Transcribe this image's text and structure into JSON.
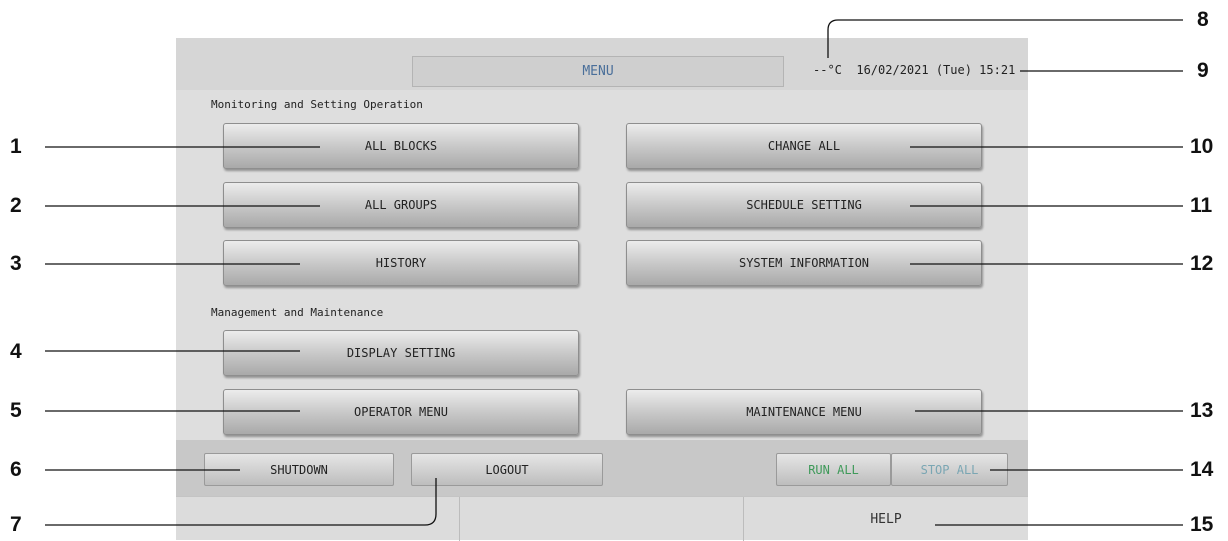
{
  "header": {
    "menu_title": "MENU",
    "status_text": "--°C  16/02/2021 (Tue) 15:21"
  },
  "sections": {
    "monitoring_label": "Monitoring and Setting Operation",
    "management_label": "Management and Maintenance"
  },
  "buttons": {
    "all_blocks": "ALL BLOCKS",
    "all_groups": "ALL GROUPS",
    "history": "HISTORY",
    "change_all": "CHANGE ALL",
    "schedule_setting": "SCHEDULE SETTING",
    "system_information": "SYSTEM INFORMATION",
    "display_setting": "DISPLAY SETTING",
    "operator_menu": "OPERATOR MENU",
    "maintenance_menu": "MAINTENANCE MENU"
  },
  "bottom_bar": {
    "shutdown": "SHUTDOWN",
    "logout": "LOGOUT",
    "run_all": "RUN ALL",
    "stop_all": "STOP ALL"
  },
  "footer": {
    "cell1": "",
    "cell2": "",
    "help": "HELP"
  },
  "callouts": [
    "1",
    "2",
    "3",
    "4",
    "5",
    "6",
    "7",
    "8",
    "9",
    "10",
    "11",
    "12",
    "13",
    "14",
    "15"
  ],
  "colors": {
    "run_all_text": "#3f9a5a",
    "stop_all_text": "#7aa6b3",
    "menu_title_text": "#4a6f9a"
  }
}
